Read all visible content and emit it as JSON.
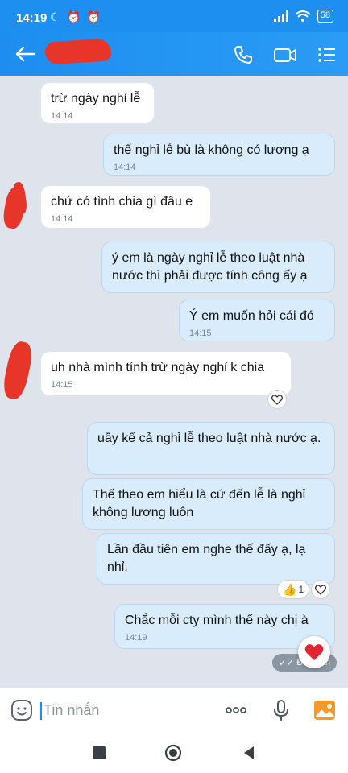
{
  "status_bar": {
    "time": "14:19",
    "battery": "58"
  },
  "header": {
    "contact_name": ""
  },
  "messages": [
    {
      "dir": "in",
      "text": "trừ ngày nghỉ lễ",
      "time": "14:14"
    },
    {
      "dir": "out",
      "text": "thế nghỉ lễ bù là không có lương ạ",
      "time": "14:14"
    },
    {
      "dir": "in",
      "text": "chứ có tình chia gì đâu e",
      "time": "14:14"
    },
    {
      "dir": "out",
      "text": "ý em là ngày nghỉ lễ theo luật nhà nước thì phải được tính công ấy ạ",
      "time": ""
    },
    {
      "dir": "out",
      "text": "Ý em muốn hỏi cái đó",
      "time": "14:15"
    },
    {
      "dir": "in",
      "text": "uh nhà mình tính trừ ngày nghỉ k chia",
      "time": "14:15"
    },
    {
      "dir": "out",
      "text": "uầy kể cả nghỉ lễ theo luật nhà nước ạ.",
      "time": ""
    },
    {
      "dir": "out",
      "text": "Thế theo em hiểu là cứ đến lễ là nghỉ không lương luôn",
      "time": ""
    },
    {
      "dir": "out",
      "text": "Lần đầu tiên em nghe thế đấy ạ, lạ nhỉ.",
      "time": ""
    },
    {
      "dir": "out",
      "text": "Chắc mỗi cty mình thế này chị à",
      "time": "14:19"
    }
  ],
  "reactions": {
    "like_count": "1"
  },
  "seen_label": "Đã nhận",
  "composer": {
    "placeholder": "Tin nhắn"
  },
  "colors": {
    "header": "#1c8ff0",
    "bubble_out": "#d8ecfc",
    "bubble_in": "#ffffff",
    "background": "#dfe4ec"
  }
}
